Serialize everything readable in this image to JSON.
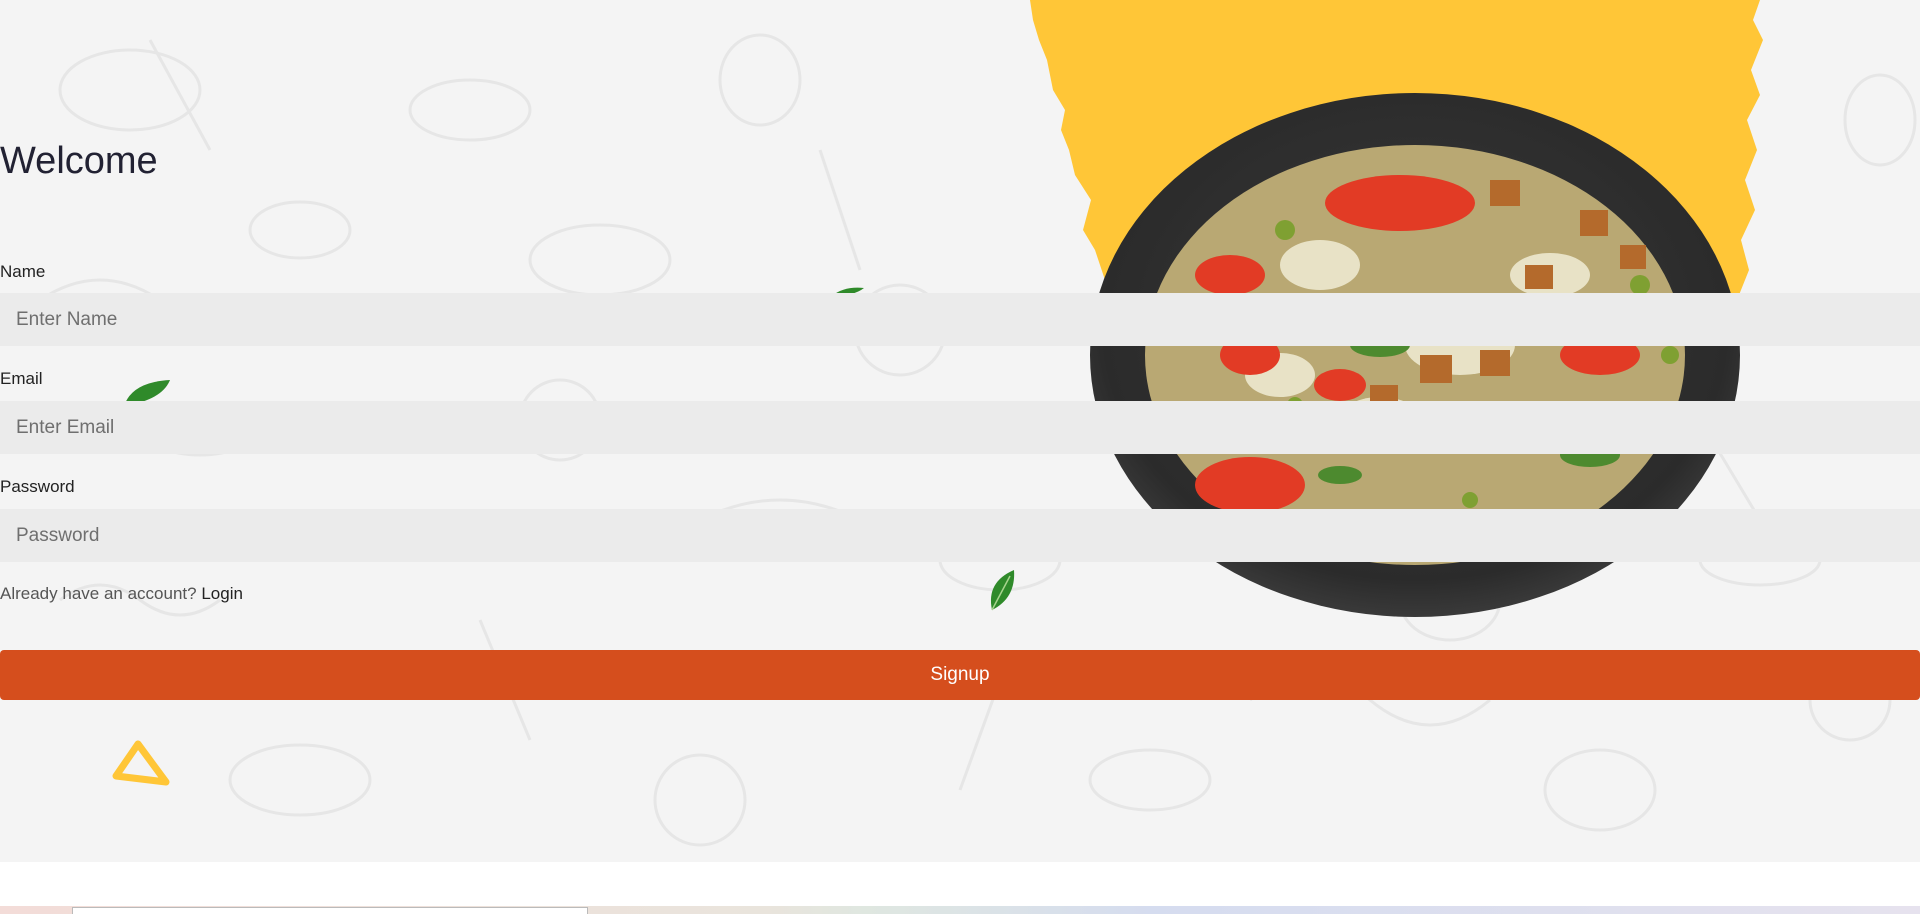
{
  "form": {
    "title": "Welcome",
    "name_label": "Name",
    "name_placeholder": "Enter Name",
    "email_label": "Email",
    "email_placeholder": "Enter Email",
    "password_label": "Password",
    "password_placeholder": "Password",
    "account_prompt": "Already have an account?",
    "login_link": "Login",
    "signup_button": "Signup"
  },
  "theme": {
    "accent": "#d54e1d",
    "splash": "#ffc637",
    "background": "#f4f4f4",
    "input_bg": "#ebebeb"
  }
}
